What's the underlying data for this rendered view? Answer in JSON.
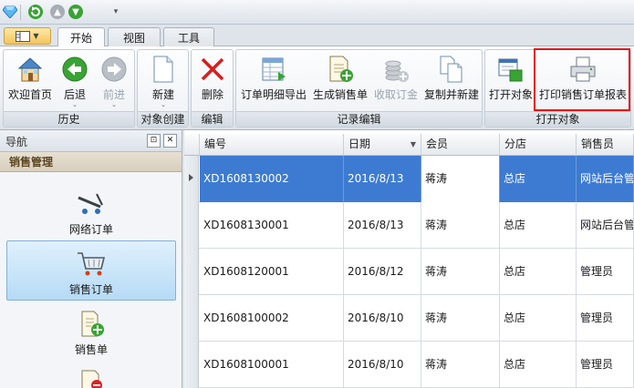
{
  "tabs": [
    {
      "label": "开始",
      "active": true
    },
    {
      "label": "视图",
      "active": false
    },
    {
      "label": "工具",
      "active": false
    }
  ],
  "ribbon": {
    "groups": [
      {
        "label": "历史",
        "buttons": [
          {
            "label": "欢迎首页",
            "icon": "house-icon",
            "enabled": true
          },
          {
            "label": "后退",
            "icon": "back-arrow-icon",
            "enabled": true
          },
          {
            "label": "前进",
            "icon": "forward-arrow-icon",
            "enabled": false
          }
        ]
      },
      {
        "label": "对象创建",
        "buttons": [
          {
            "label": "新建",
            "icon": "new-document-icon",
            "enabled": true
          }
        ]
      },
      {
        "label": "编辑",
        "buttons": [
          {
            "label": "删除",
            "icon": "delete-x-icon",
            "enabled": true
          }
        ]
      },
      {
        "label": "记录编辑",
        "buttons": [
          {
            "label": "订单明细导出",
            "icon": "export-table-icon",
            "enabled": true
          },
          {
            "label": "生成销售单",
            "icon": "generate-document-icon",
            "enabled": true
          },
          {
            "label": "收取订金",
            "icon": "coins-icon",
            "enabled": false
          },
          {
            "label": "复制并新建",
            "icon": "copy-document-icon",
            "enabled": true
          }
        ]
      },
      {
        "label": "打开对象",
        "buttons": [
          {
            "label": "打开对象",
            "icon": "open-object-icon",
            "enabled": true
          },
          {
            "label": "打印销售订单报表",
            "icon": "printer-icon",
            "enabled": true
          }
        ]
      }
    ]
  },
  "nav": {
    "title": "导航",
    "pin_glyph": "⊡",
    "close_glyph": "✕",
    "section": "销售管理",
    "items": [
      {
        "label": "网络订单",
        "icon": "cart-icon",
        "selected": false
      },
      {
        "label": "销售订单",
        "icon": "shopping-cart-icon",
        "selected": true
      },
      {
        "label": "销售单",
        "icon": "sales-document-icon",
        "selected": false
      }
    ]
  },
  "grid": {
    "columns": [
      "编号",
      "日期",
      "会员",
      "分店",
      "销售员"
    ],
    "sort_column": "日期",
    "rows": [
      [
        "XD1608130002",
        "2016/8/13",
        "蒋涛",
        "总店",
        "网站后台管"
      ],
      [
        "XD1608130001",
        "2016/8/13",
        "蒋涛",
        "总店",
        "网站后台管"
      ],
      [
        "XD1608120001",
        "2016/8/12",
        "蒋涛",
        "总店",
        "管理员"
      ],
      [
        "XD1608100002",
        "2016/8/10",
        "蒋涛",
        "总店",
        "管理员"
      ],
      [
        "XD1608100001",
        "2016/8/10",
        "蒋涛",
        "总店",
        "管理员"
      ]
    ],
    "selected_row": 0
  },
  "colors": {
    "selection": "#3d7bd3",
    "highlight_box": "#e3141b",
    "nav_selected": "#b6dbf6"
  }
}
